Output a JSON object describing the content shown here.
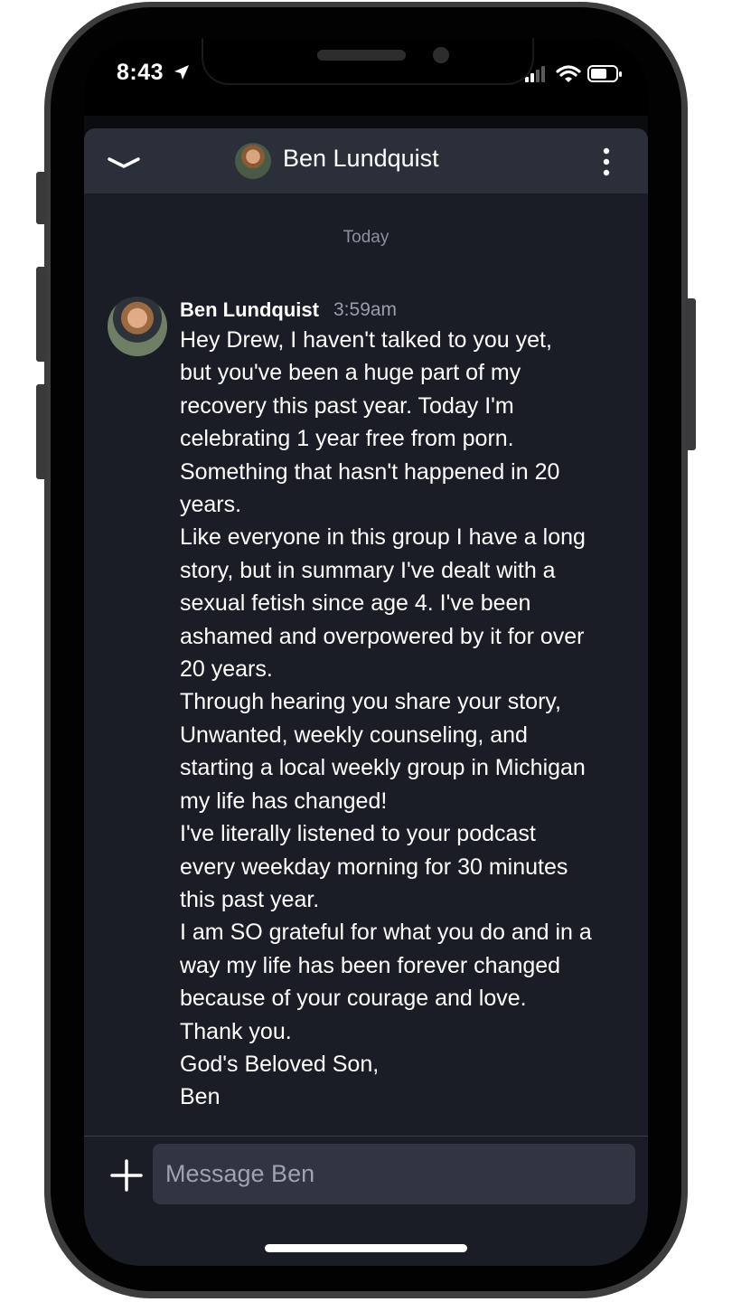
{
  "status_bar": {
    "time": "8:43"
  },
  "chat": {
    "contact_name": "Ben Lundquist",
    "date_separator": "Today",
    "message": {
      "sender": "Ben Lundquist",
      "time": "3:59am",
      "lines": [
        "Hey Drew, I haven't talked to you yet,",
        "but you've been a huge part of my",
        "recovery this past year. Today I'm",
        "celebrating 1 year free from porn.",
        "Something that hasn't happened in 20",
        "years.",
        "Like everyone in this group I have a long",
        "story, but in summary I've dealt with a",
        "sexual fetish since age 4. I've been",
        "ashamed and overpowered by it for over",
        "20 years.",
        "Through hearing you share your story,",
        "Unwanted, weekly counseling, and",
        "starting a local weekly group in Michigan",
        "my life has changed!",
        "I've literally listened to your podcast",
        "every weekday morning for 30 minutes",
        "this past year.",
        "I am SO grateful for what you do and in a",
        "way my life has been forever changed",
        "because of your courage and love.",
        "Thank you.",
        "God's Beloved Son,",
        "Ben"
      ]
    },
    "input": {
      "placeholder": "Message Ben",
      "value": ""
    }
  },
  "icons": {
    "location": "location-arrow-icon",
    "signal": "cellular-signal-icon",
    "wifi": "wifi-icon",
    "battery": "battery-icon",
    "collapse": "chevron-down-icon",
    "menu": "more-vertical-icon",
    "add": "plus-icon"
  },
  "colors": {
    "sheet_background": "#1a1d26",
    "header_background": "#2b2f3a",
    "input_background": "#313541",
    "muted_text": "#8d919b"
  }
}
